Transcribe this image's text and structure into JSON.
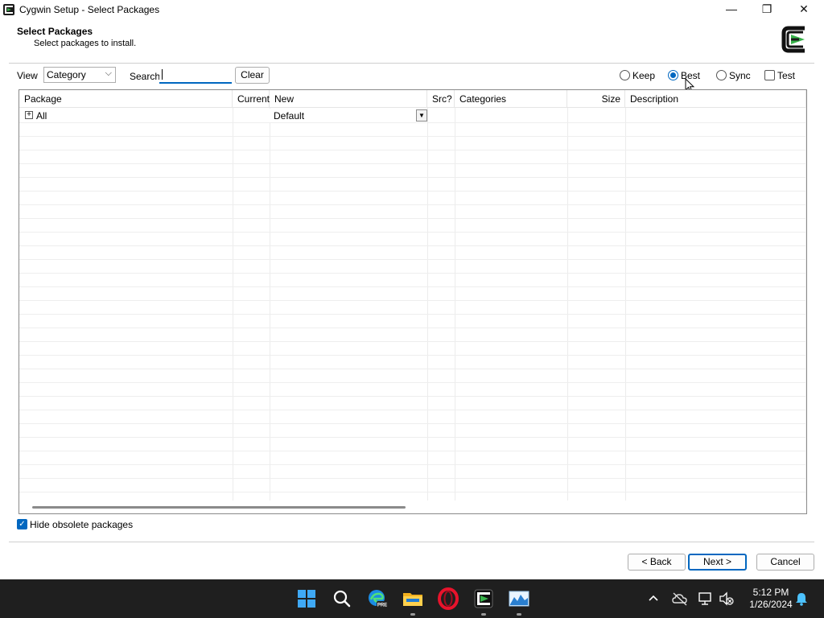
{
  "window": {
    "title": "Cygwin Setup - Select Packages",
    "minimize_glyph": "—",
    "restore_glyph": "❐",
    "close_glyph": "✕"
  },
  "header": {
    "title": "Select Packages",
    "subtitle": "Select packages to install."
  },
  "toolbar": {
    "view_label": "View",
    "view_value": "Category",
    "search_label": "Search",
    "search_value": "",
    "clear_label": "Clear",
    "radios": [
      {
        "label": "Keep",
        "checked": false
      },
      {
        "label": "Best",
        "checked": true
      },
      {
        "label": "Sync",
        "checked": false
      }
    ],
    "test_label": "Test",
    "test_checked": false
  },
  "table": {
    "columns": [
      "Package",
      "Current",
      "New",
      "Src?",
      "Categories",
      "Size",
      "Description"
    ],
    "rows": [
      {
        "package": "All",
        "current": "",
        "new": "Default",
        "src": "",
        "categories": "",
        "size": "",
        "description": ""
      }
    ]
  },
  "bottom": {
    "hide_obsolete_label": "Hide obsolete packages",
    "hide_obsolete_checked": true,
    "back_label": "< Back",
    "next_label": "Next >",
    "cancel_label": "Cancel"
  },
  "taskbar": {
    "icons": [
      "windows-start-icon",
      "search-icon",
      "edge-preview-icon",
      "file-explorer-icon",
      "opera-icon",
      "cygwin-setup-icon",
      "image-viewer-icon"
    ],
    "time": "5:12 PM",
    "date": "1/26/2024"
  },
  "colors": {
    "accent": "#0067c0",
    "taskbar_bg": "#1f1f1f",
    "cygwin_green": "#37b34a"
  }
}
